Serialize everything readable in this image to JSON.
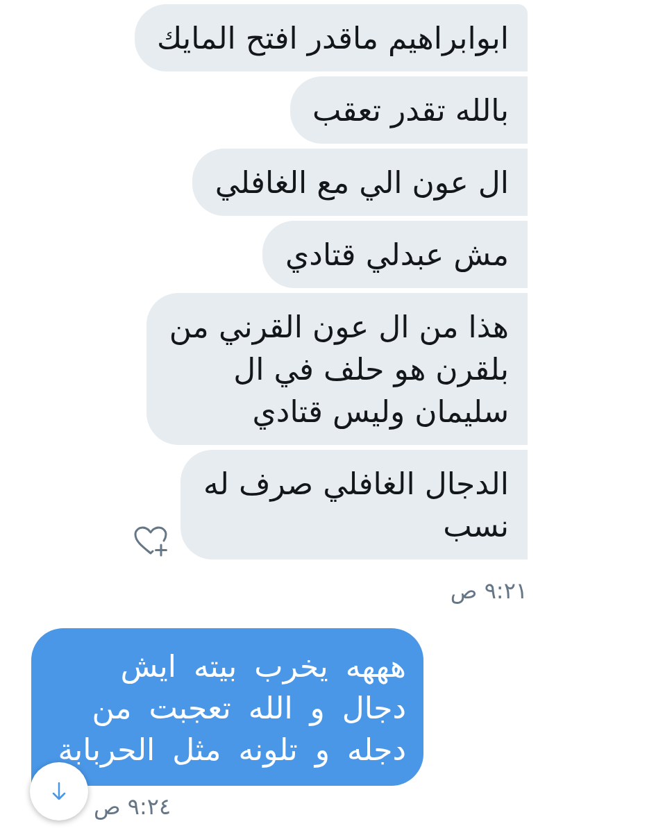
{
  "conversation": [
    {
      "kind": "received",
      "messages": [
        {
          "text": "ابوابراهيم ماقدر افتح المايك"
        },
        {
          "text": "بالله تقدر تعقب"
        },
        {
          "text": "ال عون الي مع الغافلي"
        },
        {
          "text": "مش عبدلي قتادي"
        },
        {
          "text": "هذا من ال عون القرني من بلقرن هو حلف في ال سليمان وليس قتادي"
        },
        {
          "text": "الدجال الغافلي صرف له نسب"
        }
      ],
      "time": "٩:٢١ ص"
    },
    {
      "kind": "sent",
      "messages": [
        {
          "text": "هههه يخرب بيته ايش دجال و الله تعجبت من دجله و تلونه مثل الحربابة"
        }
      ],
      "time": "٩:٢٤ ص"
    }
  ]
}
